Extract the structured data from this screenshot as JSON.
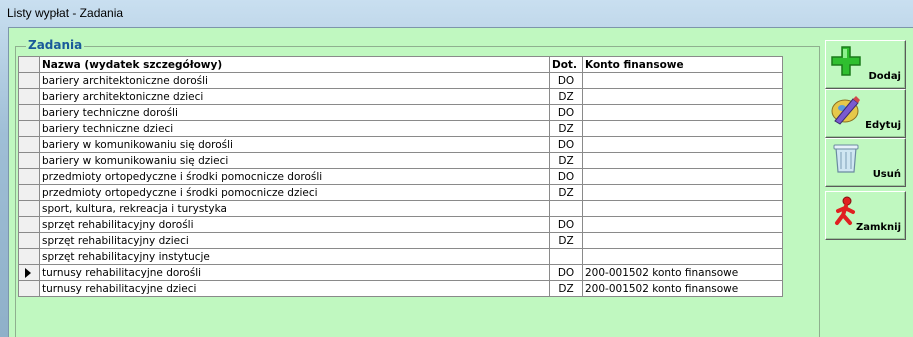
{
  "window": {
    "title": "Listy wypłat - Zadania"
  },
  "group": {
    "label": "Zadania"
  },
  "table": {
    "columns": [
      "Nazwa (wydatek szczegółowy)",
      "Dot.",
      "Konto finansowe"
    ],
    "rows": [
      {
        "name": "bariery architektoniczne dorośli",
        "dot": "DO",
        "konto": ""
      },
      {
        "name": "bariery architektoniczne dzieci",
        "dot": "DZ",
        "konto": ""
      },
      {
        "name": "bariery techniczne dorośli",
        "dot": "DO",
        "konto": ""
      },
      {
        "name": "bariery techniczne dzieci",
        "dot": "DZ",
        "konto": ""
      },
      {
        "name": "bariery w komunikowaniu się dorośli",
        "dot": "DO",
        "konto": ""
      },
      {
        "name": "bariery w komunikowaniu się dzieci",
        "dot": "DZ",
        "konto": ""
      },
      {
        "name": "przedmioty ortopedyczne i środki pomocnicze dorośli",
        "dot": "DO",
        "konto": ""
      },
      {
        "name": "przedmioty ortopedyczne i środki pomocnicze dzieci",
        "dot": "DZ",
        "konto": ""
      },
      {
        "name": "sport, kultura, rekreacja i turystyka",
        "dot": "",
        "konto": ""
      },
      {
        "name": "sprzęt rehabilitacyjny dorośli",
        "dot": "DO",
        "konto": ""
      },
      {
        "name": "sprzęt rehabilitacyjny dzieci",
        "dot": "DZ",
        "konto": ""
      },
      {
        "name": "sprzęt rehabilitacyjny instytucje",
        "dot": "",
        "konto": ""
      },
      {
        "name": "turnusy rehabilitacyjne dorośli",
        "dot": "DO",
        "konto": "200-001502 konto finansowe"
      },
      {
        "name": "turnusy rehabilitacyjne dzieci",
        "dot": "DZ",
        "konto": "200-001502 konto finansowe"
      }
    ],
    "current_row": 12
  },
  "buttons": {
    "add": "Dodaj",
    "edit": "Edytuj",
    "delete": "Usuń",
    "close": "Zamknij"
  },
  "icons": {
    "add": "green-plus-icon",
    "edit": "pencil-edit-icon",
    "delete": "trash-bin-icon",
    "close": "red-person-exit-icon"
  }
}
